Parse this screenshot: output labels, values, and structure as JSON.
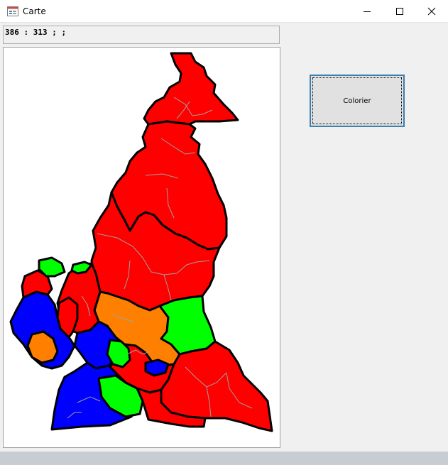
{
  "window": {
    "title": "Carte",
    "app_icon": "form-icon",
    "controls": [
      "minimize-icon",
      "maximize-icon",
      "close-icon"
    ]
  },
  "coordinates_readout": "386 : 313 ; ;",
  "map": {
    "subject": "Cameroon regions and departments",
    "fill_colors": {
      "red": "#ff0000",
      "green": "#00ff00",
      "blue": "#0000ff",
      "orange": "#ff8000"
    },
    "border_color": "#000000",
    "sub_border_color": "#a0a0a0"
  },
  "buttons": {
    "colorize_label": "Colorier"
  },
  "colors": {
    "button_face": "#e1e1e1",
    "button_focus_border": "#3c7fb1",
    "window_bg": "#f0f0f0"
  }
}
